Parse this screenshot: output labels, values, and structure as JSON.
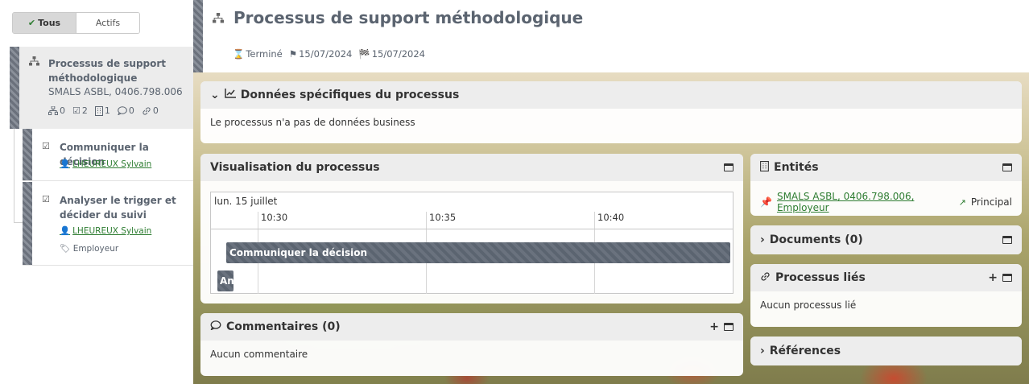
{
  "filter": {
    "all_label": "Tous",
    "active_label": "Actifs"
  },
  "process": {
    "title": "Processus de support méthodologique",
    "org": "SMALS ASBL, 0406.798.006",
    "stats": {
      "subprocesses": "0",
      "tasks": "2",
      "entities": "1",
      "comments": "0",
      "links": "0"
    }
  },
  "tasks": [
    {
      "title": "Communiquer la décision",
      "assignee": "LHEUREUX Sylvain"
    },
    {
      "title": "Analyser le trigger et décider du suivi",
      "assignee": "LHEUREUX Sylvain",
      "role": "Employeur"
    }
  ],
  "header": {
    "title": "Processus de support méthodologique",
    "status": "Terminé",
    "start_date": "15/07/2024",
    "end_date": "15/07/2024"
  },
  "panels": {
    "data": {
      "title": "Données spécifiques du processus",
      "body": "Le processus n'a pas de données business"
    },
    "visualisation": {
      "title": "Visualisation du processus",
      "day": "lun. 15 juillet",
      "ticks": [
        "10:30",
        "10:35",
        "10:40"
      ],
      "bars": [
        "Communiquer la décision",
        "An"
      ]
    },
    "comments": {
      "title": "Commentaires (0)",
      "body": "Aucun commentaire"
    },
    "entities": {
      "title": "Entités",
      "entity": "SMALS ASBL, 0406.798.006, Employeur",
      "role": "Principal"
    },
    "documents": {
      "title": "Documents (0)"
    },
    "linked": {
      "title": "Processus liés",
      "body": "Aucun processus lié"
    },
    "references": {
      "title": "Références"
    }
  },
  "colors": {
    "accent_green": "#2e7d32",
    "stripe": "#6b717c",
    "title_gray": "#5b6470"
  }
}
